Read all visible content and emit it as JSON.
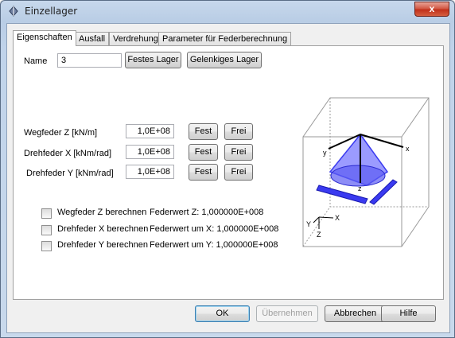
{
  "window": {
    "title": "Einzellager",
    "close_symbol": "x"
  },
  "tabs": [
    {
      "label": "Eigenschaften",
      "active": true
    },
    {
      "label": "Ausfall",
      "active": false
    },
    {
      "label": "Verdrehung",
      "active": false
    },
    {
      "label": "Parameter für Federberechnung",
      "active": false
    }
  ],
  "name_field": {
    "label": "Name",
    "value": "3"
  },
  "presets": {
    "fixed_label": "Festes Lager",
    "hinged_label": "Gelenkiges Lager"
  },
  "springs": [
    {
      "label": "Wegfeder Z [kN/m]",
      "value": "1,0E+08",
      "fest": "Fest",
      "frei": "Frei"
    },
    {
      "label": "Drehfeder X [kNm/rad]",
      "value": "1,0E+08",
      "fest": "Fest",
      "frei": "Frei"
    },
    {
      "label": "Drehfeder Y [kNm/rad]",
      "value": "1,0E+08",
      "fest": "Fest",
      "frei": "Frei"
    }
  ],
  "calculations": [
    {
      "label": "Wegfeder Z berechnen",
      "result": "Federwert Z: 1,000000E+008",
      "checked": false
    },
    {
      "label": "Drehfeder X berechnen",
      "result": "Federwert um X: 1,000000E+008",
      "checked": false
    },
    {
      "label": "Drehfeder Y berechnen",
      "result": "Federwert um Y: 1,000000E+008",
      "checked": false
    }
  ],
  "diagram": {
    "axes_top": {
      "x": "x",
      "y": "y",
      "z": "z"
    },
    "axes_legend": {
      "x": "X",
      "y": "Y",
      "z": "Z"
    },
    "colors": {
      "support": "#3a3af0",
      "cone": "#8a8aff",
      "box": "#888888"
    }
  },
  "footer": {
    "ok": "OK",
    "apply": "Übernehmen",
    "cancel": "Abbrechen",
    "help": "Hilfe"
  }
}
